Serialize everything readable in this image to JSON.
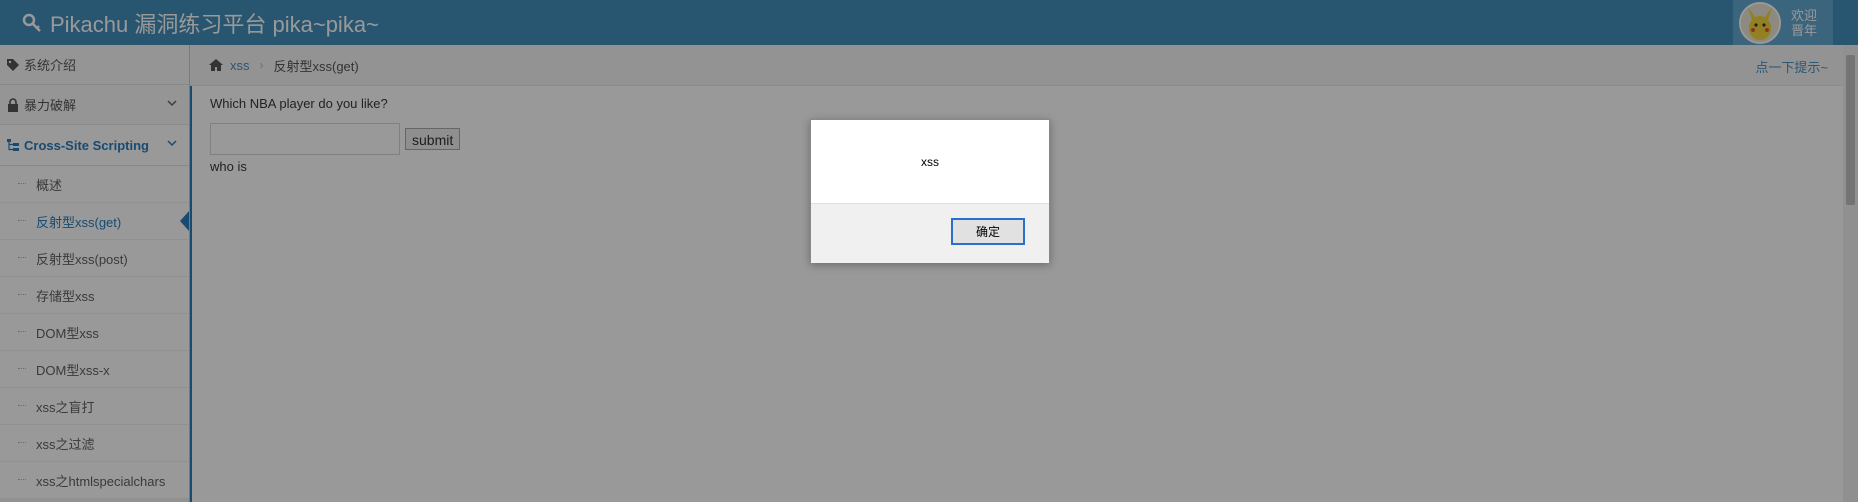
{
  "navbar": {
    "title": "Pikachu 漏洞练习平台 pika~pika~",
    "welcome_line1": "欢迎",
    "welcome_line2": "晋年",
    "icon": "key-icon",
    "bg_color": "#438eb9"
  },
  "sidebar": {
    "items": [
      {
        "label": "系统介绍",
        "icon": "tags-icon"
      },
      {
        "label": "暴力破解",
        "icon": "lock-icon"
      },
      {
        "label": "Cross-Site Scripting",
        "icon": "sitemap-icon"
      }
    ],
    "subitems": [
      {
        "label": "概述"
      },
      {
        "label": "反射型xss(get)"
      },
      {
        "label": "反射型xss(post)"
      },
      {
        "label": "存储型xss"
      },
      {
        "label": "DOM型xss"
      },
      {
        "label": "DOM型xss-x"
      },
      {
        "label": "xss之盲打"
      },
      {
        "label": "xss之过滤"
      },
      {
        "label": "xss之htmlspecialchars"
      }
    ]
  },
  "breadcrumb": {
    "link": "xss",
    "separator": "›",
    "current": "反射型xss(get)",
    "hint": "点一下提示~"
  },
  "main": {
    "question": "Which NBA player do you like?",
    "input_value": "",
    "submit_label": "submit",
    "result": "who is"
  },
  "dialog": {
    "message": "xss",
    "ok_label": "确定"
  }
}
